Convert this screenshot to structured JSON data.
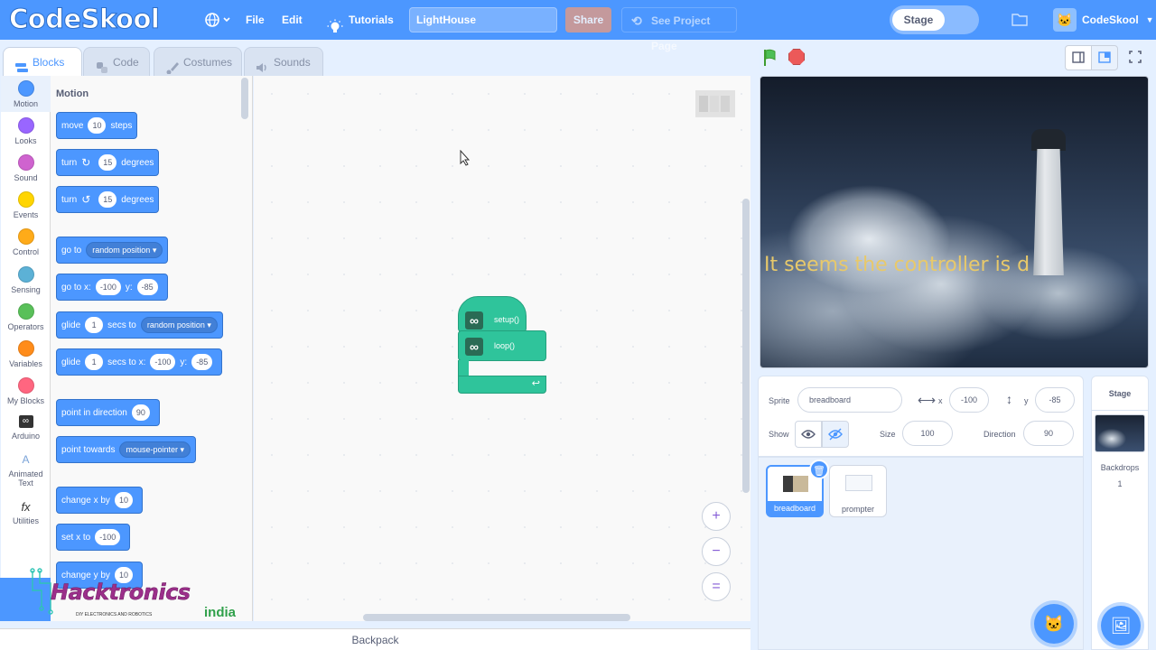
{
  "menubar": {
    "logo": "CodeSkool",
    "file": "File",
    "edit": "Edit",
    "tutorials": "Tutorials",
    "project_title": "LightHouse",
    "share": "Share",
    "see_project_page": "See Project Page",
    "stage_toggle": "Stage",
    "account_name": "CodeSkool",
    "accent": "#4c97ff"
  },
  "tabs": [
    {
      "label": "Blocks",
      "icon": "blocks-icon"
    },
    {
      "label": "Code",
      "icon": "python-icon"
    },
    {
      "label": "Costumes",
      "icon": "brush-icon"
    },
    {
      "label": "Sounds",
      "icon": "speaker-icon"
    }
  ],
  "categories": [
    {
      "label": "Motion",
      "color": "#4c97ff"
    },
    {
      "label": "Looks",
      "color": "#9966ff"
    },
    {
      "label": "Sound",
      "color": "#cf63cf"
    },
    {
      "label": "Events",
      "color": "#ffd500"
    },
    {
      "label": "Control",
      "color": "#ffab19"
    },
    {
      "label": "Sensing",
      "color": "#5cb1d6"
    },
    {
      "label": "Operators",
      "color": "#59c059"
    },
    {
      "label": "Variables",
      "color": "#ff8c1a"
    },
    {
      "label": "My Blocks",
      "color": "#ff6680"
    },
    {
      "label": "Arduino",
      "color": "#2a6b55"
    },
    {
      "label": "Animated Text",
      "color": "#7aa3d8"
    },
    {
      "label": "Utilities",
      "color": "#333333"
    }
  ],
  "palette": {
    "title": "Motion",
    "blocks": {
      "move": {
        "a": "move",
        "v1": "10",
        "b": "steps"
      },
      "turn_cw": {
        "a": "turn",
        "v1": "15",
        "b": "degrees"
      },
      "turn_ccw": {
        "a": "turn",
        "v1": "15",
        "b": "degrees"
      },
      "goto": {
        "a": "go to",
        "d1": "random position"
      },
      "goto_xy": {
        "a": "go to x:",
        "v1": "-100",
        "b": "y:",
        "v2": "-85"
      },
      "glide": {
        "a": "glide",
        "v1": "1",
        "b": "secs to",
        "d1": "random position"
      },
      "glide_xy": {
        "a": "glide",
        "v1": "1",
        "b": "secs to x:",
        "v2": "-100",
        "c": "y:",
        "v3": "-85"
      },
      "point_dir": {
        "a": "point in direction",
        "v1": "90"
      },
      "point_towards": {
        "a": "point towards",
        "d1": "mouse-pointer"
      },
      "change_x": {
        "a": "change x by",
        "v1": "10"
      },
      "set_x": {
        "a": "set x to",
        "v1": "-100"
      },
      "change_y": {
        "a": "change y by",
        "v1": "10"
      }
    }
  },
  "script": {
    "setup": "setup()",
    "loop": "loop()"
  },
  "zoom": {
    "in": "+",
    "out": "−",
    "reset": "="
  },
  "backpack": "Backpack",
  "watermark": {
    "brand": "Hacktronics",
    "tagline": "DIY ELECTRONICS AND ROBOTICS",
    "country": "india"
  },
  "stage": {
    "caption": "It seems the controller is d"
  },
  "sprite_info": {
    "sprite_label": "Sprite",
    "sprite_name": "breadboard",
    "x_label": "x",
    "x_value": "-100",
    "y_label": "y",
    "y_value": "-85",
    "show_label": "Show",
    "size_label": "Size",
    "size_value": "100",
    "direction_label": "Direction",
    "direction_value": "90"
  },
  "sprites": [
    {
      "name": "breadboard",
      "selected": true
    },
    {
      "name": "prompter",
      "selected": false
    }
  ],
  "stage_panel": {
    "title": "Stage",
    "backdrops_label": "Backdrops",
    "backdrops_count": "1"
  }
}
